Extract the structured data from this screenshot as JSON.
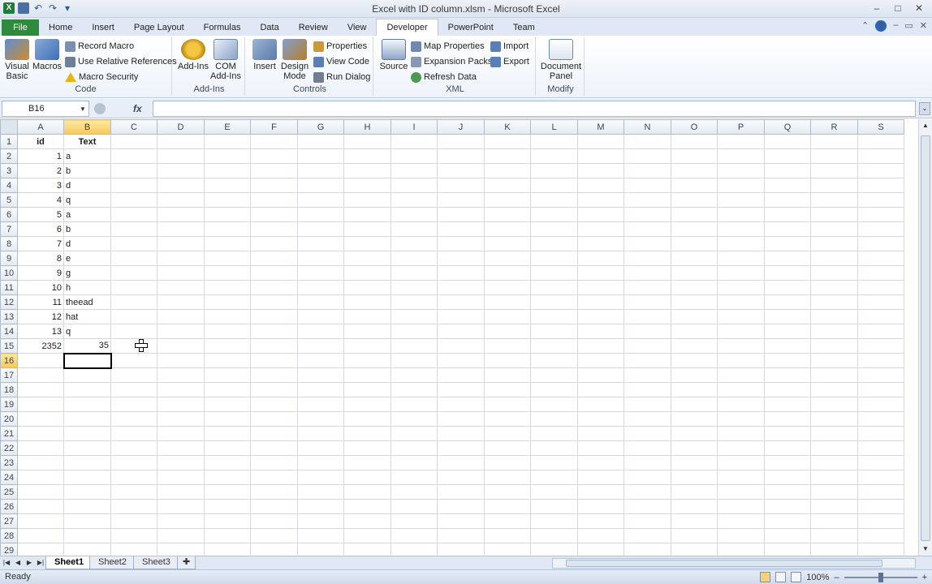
{
  "window": {
    "title": "Excel with ID column.xlsm - Microsoft Excel",
    "minimize": "–",
    "maximize": "□",
    "close": "✕"
  },
  "tabs": [
    "File",
    "Home",
    "Insert",
    "Page Layout",
    "Formulas",
    "Data",
    "Review",
    "View",
    "Developer",
    "PowerPoint",
    "Team"
  ],
  "active_tab": "Developer",
  "ribbon": {
    "code": {
      "label": "Code",
      "visual_basic": "Visual Basic",
      "macros": "Macros",
      "record_macro": "Record Macro",
      "relative_refs": "Use Relative References",
      "macro_security": "Macro Security"
    },
    "addins": {
      "label": "Add-Ins",
      "addins": "Add-Ins",
      "com_addins": "COM Add-Ins"
    },
    "controls": {
      "label": "Controls",
      "insert": "Insert",
      "design_mode": "Design Mode",
      "properties": "Properties",
      "view_code": "View Code",
      "run_dialog": "Run Dialog"
    },
    "xml": {
      "label": "XML",
      "source": "Source",
      "map_properties": "Map Properties",
      "expansion_packs": "Expansion Packs",
      "refresh_data": "Refresh Data",
      "import": "Import",
      "export": "Export"
    },
    "modify": {
      "label": "Modify",
      "document_panel": "Document Panel"
    }
  },
  "formula_bar": {
    "name_box": "B16",
    "fx": "fx",
    "content": ""
  },
  "grid": {
    "columns": [
      "A",
      "B",
      "C",
      "D",
      "E",
      "F",
      "G",
      "H",
      "I",
      "J",
      "K",
      "L",
      "M",
      "N",
      "O",
      "P",
      "Q",
      "R",
      "S"
    ],
    "selected_column": "B",
    "selected_row": 16,
    "row_count": 29,
    "rows": [
      {
        "A": "id",
        "B": "Text"
      },
      {
        "A": "1",
        "B": "a"
      },
      {
        "A": "2",
        "B": "b"
      },
      {
        "A": "3",
        "B": "d"
      },
      {
        "A": "4",
        "B": "q"
      },
      {
        "A": "5",
        "B": "a"
      },
      {
        "A": "6",
        "B": "b"
      },
      {
        "A": "7",
        "B": "d"
      },
      {
        "A": "8",
        "B": "e"
      },
      {
        "A": "9",
        "B": "g"
      },
      {
        "A": "10",
        "B": "h"
      },
      {
        "A": "11",
        "B": "theead"
      },
      {
        "A": "12",
        "B": "hat"
      },
      {
        "A": "13",
        "B": "q"
      },
      {
        "A": "2352",
        "B": "35"
      }
    ]
  },
  "sheets": [
    "Sheet1",
    "Sheet2",
    "Sheet3"
  ],
  "active_sheet": "Sheet1",
  "status": {
    "ready": "Ready",
    "zoom": "100%"
  }
}
